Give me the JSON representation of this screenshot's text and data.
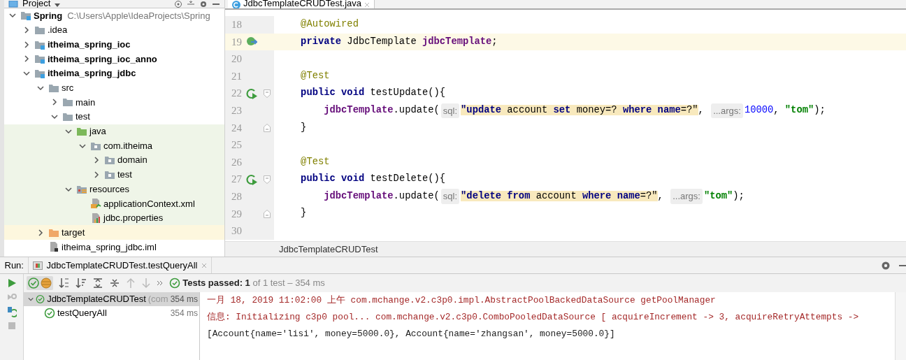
{
  "project_panel": {
    "title": "Project",
    "tree": [
      {
        "label": "Spring",
        "path": "C:\\Users\\Apple\\IdeaProjects\\Spring",
        "kind": "module",
        "bold": true,
        "expanded": true,
        "children": [
          {
            "label": ".idea",
            "kind": "folder",
            "bold": false,
            "expanded": false
          },
          {
            "label": "itheima_spring_ioc",
            "kind": "module",
            "bold": true,
            "expanded": false
          },
          {
            "label": "itheima_spring_ioc_anno",
            "kind": "module",
            "bold": true,
            "expanded": false
          },
          {
            "label": "itheima_spring_jdbc",
            "kind": "module",
            "bold": true,
            "expanded": true,
            "children": [
              {
                "label": "src",
                "kind": "folder",
                "bold": false,
                "expanded": true,
                "children": [
                  {
                    "label": "main",
                    "kind": "folder",
                    "bold": false,
                    "expanded": false
                  },
                  {
                    "label": "test",
                    "kind": "folder",
                    "bold": false,
                    "expanded": true,
                    "children": [
                      {
                        "label": "java",
                        "kind": "testroot",
                        "bold": false,
                        "expanded": true,
                        "children": [
                          {
                            "label": "com.itheima",
                            "kind": "package",
                            "bold": false,
                            "expanded": true,
                            "children": [
                              {
                                "label": "domain",
                                "kind": "package",
                                "bold": false,
                                "expanded": false
                              },
                              {
                                "label": "test",
                                "kind": "package",
                                "bold": false,
                                "expanded": false
                              }
                            ]
                          }
                        ]
                      },
                      {
                        "label": "resources",
                        "kind": "testresources",
                        "bold": false,
                        "expanded": true,
                        "children": [
                          {
                            "label": "applicationContext.xml",
                            "kind": "xml",
                            "bold": false
                          },
                          {
                            "label": "jdbc.properties",
                            "kind": "properties",
                            "bold": false
                          }
                        ]
                      }
                    ]
                  }
                ]
              },
              {
                "label": "target",
                "kind": "excluded",
                "bold": false,
                "expanded": false
              },
              {
                "label": "itheima_spring_jdbc.iml",
                "kind": "iml",
                "bold": false
              }
            ]
          }
        ]
      }
    ]
  },
  "editor": {
    "tabs": [
      {
        "label": "JdbcTemplateCRUDTest.java",
        "selected": true
      }
    ],
    "lines": [
      {
        "number": "18",
        "kind": "plain",
        "current": false,
        "tokens": [
          {
            "kind": "annotation",
            "text": "    @Autowired"
          }
        ]
      },
      {
        "number": "19",
        "kind": "bean",
        "current": true,
        "tokens": [
          {
            "kind": "keyword",
            "text": "    private"
          },
          {
            "kind": "plain",
            "text": " JdbcTemplate "
          },
          {
            "kind": "field",
            "text": "jdbcTemplate"
          },
          {
            "kind": "plain",
            "text": ";"
          }
        ]
      },
      {
        "number": "20",
        "kind": "plain",
        "current": false
      },
      {
        "number": "21",
        "kind": "plain",
        "current": false,
        "tokens": [
          {
            "kind": "annotation",
            "text": "    @Test"
          }
        ]
      },
      {
        "number": "22",
        "kind": "testmethod",
        "current": false,
        "tokens": [
          {
            "kind": "keyword",
            "text": "    public void"
          },
          {
            "kind": "plain",
            "text": " testUpdate(){"
          }
        ]
      },
      {
        "number": "23",
        "kind": "plain",
        "current": false,
        "tokens": [
          {
            "kind": "field",
            "text": "        jdbcTemplate"
          },
          {
            "kind": "plain",
            "text": ".update("
          },
          {
            "kind": "hint",
            "text": "sql:"
          },
          {
            "kind": "sql_keyword",
            "text": "\"update"
          },
          {
            "kind": "sql",
            "text": " account "
          },
          {
            "kind": "sql_keyword",
            "text": "set"
          },
          {
            "kind": "sql",
            "text": " money=? "
          },
          {
            "kind": "sql_keyword",
            "text": "where name"
          },
          {
            "kind": "sql",
            "text": "=?\""
          },
          {
            "kind": "plain",
            "text": ", "
          },
          {
            "kind": "hint",
            "text": "...args:"
          },
          {
            "kind": "number",
            "text": "10000"
          },
          {
            "kind": "plain",
            "text": ", "
          },
          {
            "kind": "string",
            "text": "\"tom\""
          },
          {
            "kind": "plain",
            "text": ");"
          }
        ]
      },
      {
        "number": "24",
        "kind": "blockend",
        "current": false,
        "tokens": [
          {
            "kind": "plain",
            "text": "    }"
          }
        ]
      },
      {
        "number": "25",
        "kind": "plain",
        "current": false
      },
      {
        "number": "26",
        "kind": "plain",
        "current": false,
        "tokens": [
          {
            "kind": "annotation",
            "text": "    @Test"
          }
        ]
      },
      {
        "number": "27",
        "kind": "testmethod",
        "current": false,
        "tokens": [
          {
            "kind": "keyword",
            "text": "    public void"
          },
          {
            "kind": "plain",
            "text": " testDelete(){"
          }
        ]
      },
      {
        "number": "28",
        "kind": "plain",
        "current": false,
        "tokens": [
          {
            "kind": "field",
            "text": "        jdbcTemplate"
          },
          {
            "kind": "plain",
            "text": ".update("
          },
          {
            "kind": "hint",
            "text": "sql:"
          },
          {
            "kind": "sql_keyword",
            "text": "\"delete from"
          },
          {
            "kind": "sql",
            "text": " account "
          },
          {
            "kind": "sql_keyword",
            "text": "where name"
          },
          {
            "kind": "sql",
            "text": "=?\""
          },
          {
            "kind": "plain",
            "text": ", "
          },
          {
            "kind": "hint",
            "text": "...args:"
          },
          {
            "kind": "string",
            "text": "\"tom\""
          },
          {
            "kind": "plain",
            "text": ");"
          }
        ]
      },
      {
        "number": "29",
        "kind": "blockend",
        "current": false,
        "tokens": [
          {
            "kind": "plain",
            "text": "    }"
          }
        ]
      },
      {
        "number": "30",
        "kind": "plain",
        "current": false
      }
    ],
    "breadcrumb": "JdbcTemplateCRUDTest"
  },
  "run_panel": {
    "label": "Run:",
    "tabs": [
      {
        "label": "JdbcTemplateCRUDTest.testQueryAll",
        "selected": true
      }
    ],
    "status": "**Tests passed: 1** of 1 test – 354 ms",
    "tests": [
      {
        "name": "JdbcTemplateCRUDTest",
        "detail": "(com",
        "time": "354 ms",
        "selected": true,
        "expanded": true,
        "children": [
          {
            "name": "testQueryAll",
            "time": "354 ms",
            "selected": false
          }
        ]
      }
    ],
    "console": [
      {
        "kind": "err",
        "text": "一月 18, 2019 11:02:00 上午 com.mchange.v2.c3p0.impl.AbstractPoolBackedDataSource getPoolManager"
      },
      {
        "kind": "err",
        "text": "信息: Initializing c3p0 pool... com.mchange.v2.c3p0.ComboPooledDataSource [ acquireIncrement -> 3, acquireRetryAttempts ->"
      },
      {
        "kind": "out",
        "text": "[Account{name='lisi', money=5000.0}, Account{name='zhangsan', money=5000.0}]"
      }
    ]
  }
}
